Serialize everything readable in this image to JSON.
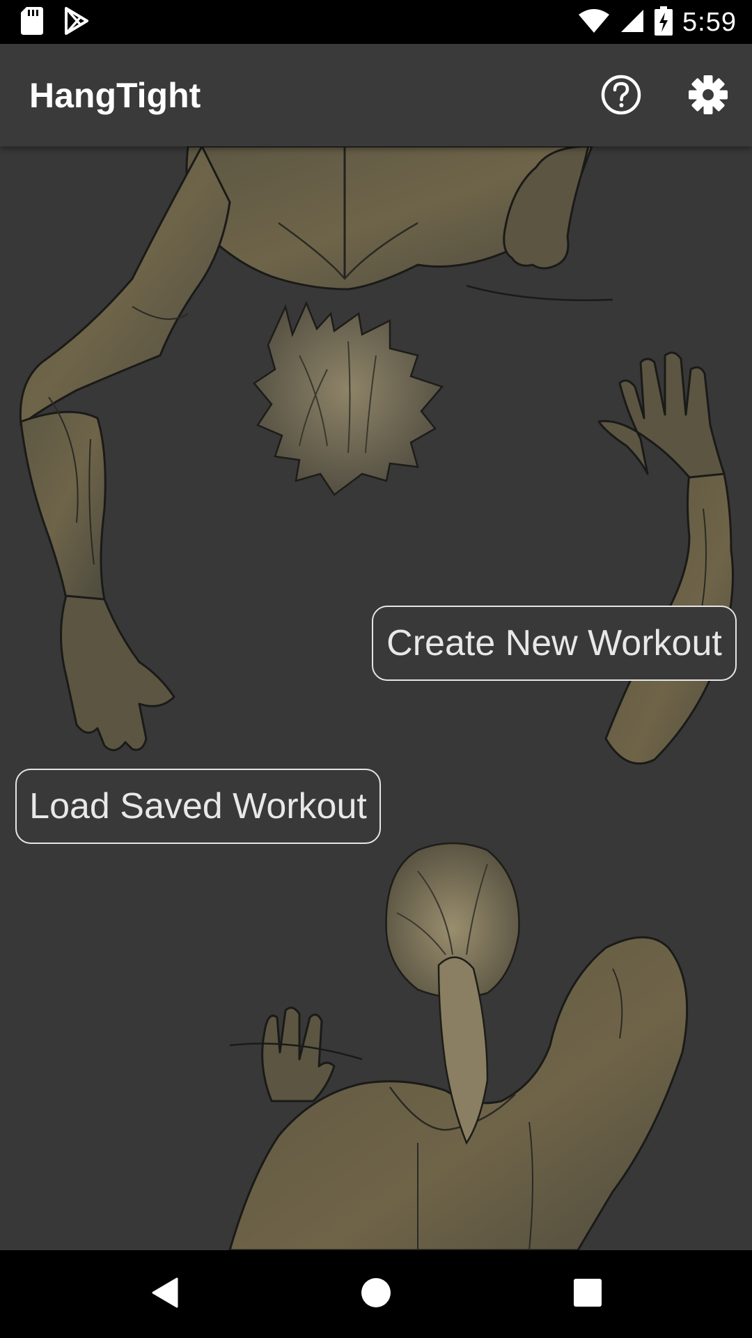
{
  "status_bar": {
    "time": "5:59",
    "icons": [
      "sd-card-icon",
      "play-store-icon",
      "wifi-icon",
      "cell-signal-icon",
      "battery-charging-icon"
    ]
  },
  "app_bar": {
    "title": "HangTight",
    "actions": [
      {
        "name": "help",
        "icon": "help-circle-icon"
      },
      {
        "name": "settings",
        "icon": "gear-icon"
      }
    ]
  },
  "main": {
    "create_button_label": "Create New Workout",
    "load_button_label": "Load Saved Workout"
  },
  "nav_bar": {
    "buttons": [
      "back-icon",
      "home-icon",
      "recents-icon"
    ]
  },
  "colors": {
    "background": "#383838",
    "app_bar": "#3a3a3a",
    "button_border": "#e6e6e6",
    "button_text": "#e8e8e8",
    "skin": "#6b6147",
    "hair": "#8a7e63"
  }
}
